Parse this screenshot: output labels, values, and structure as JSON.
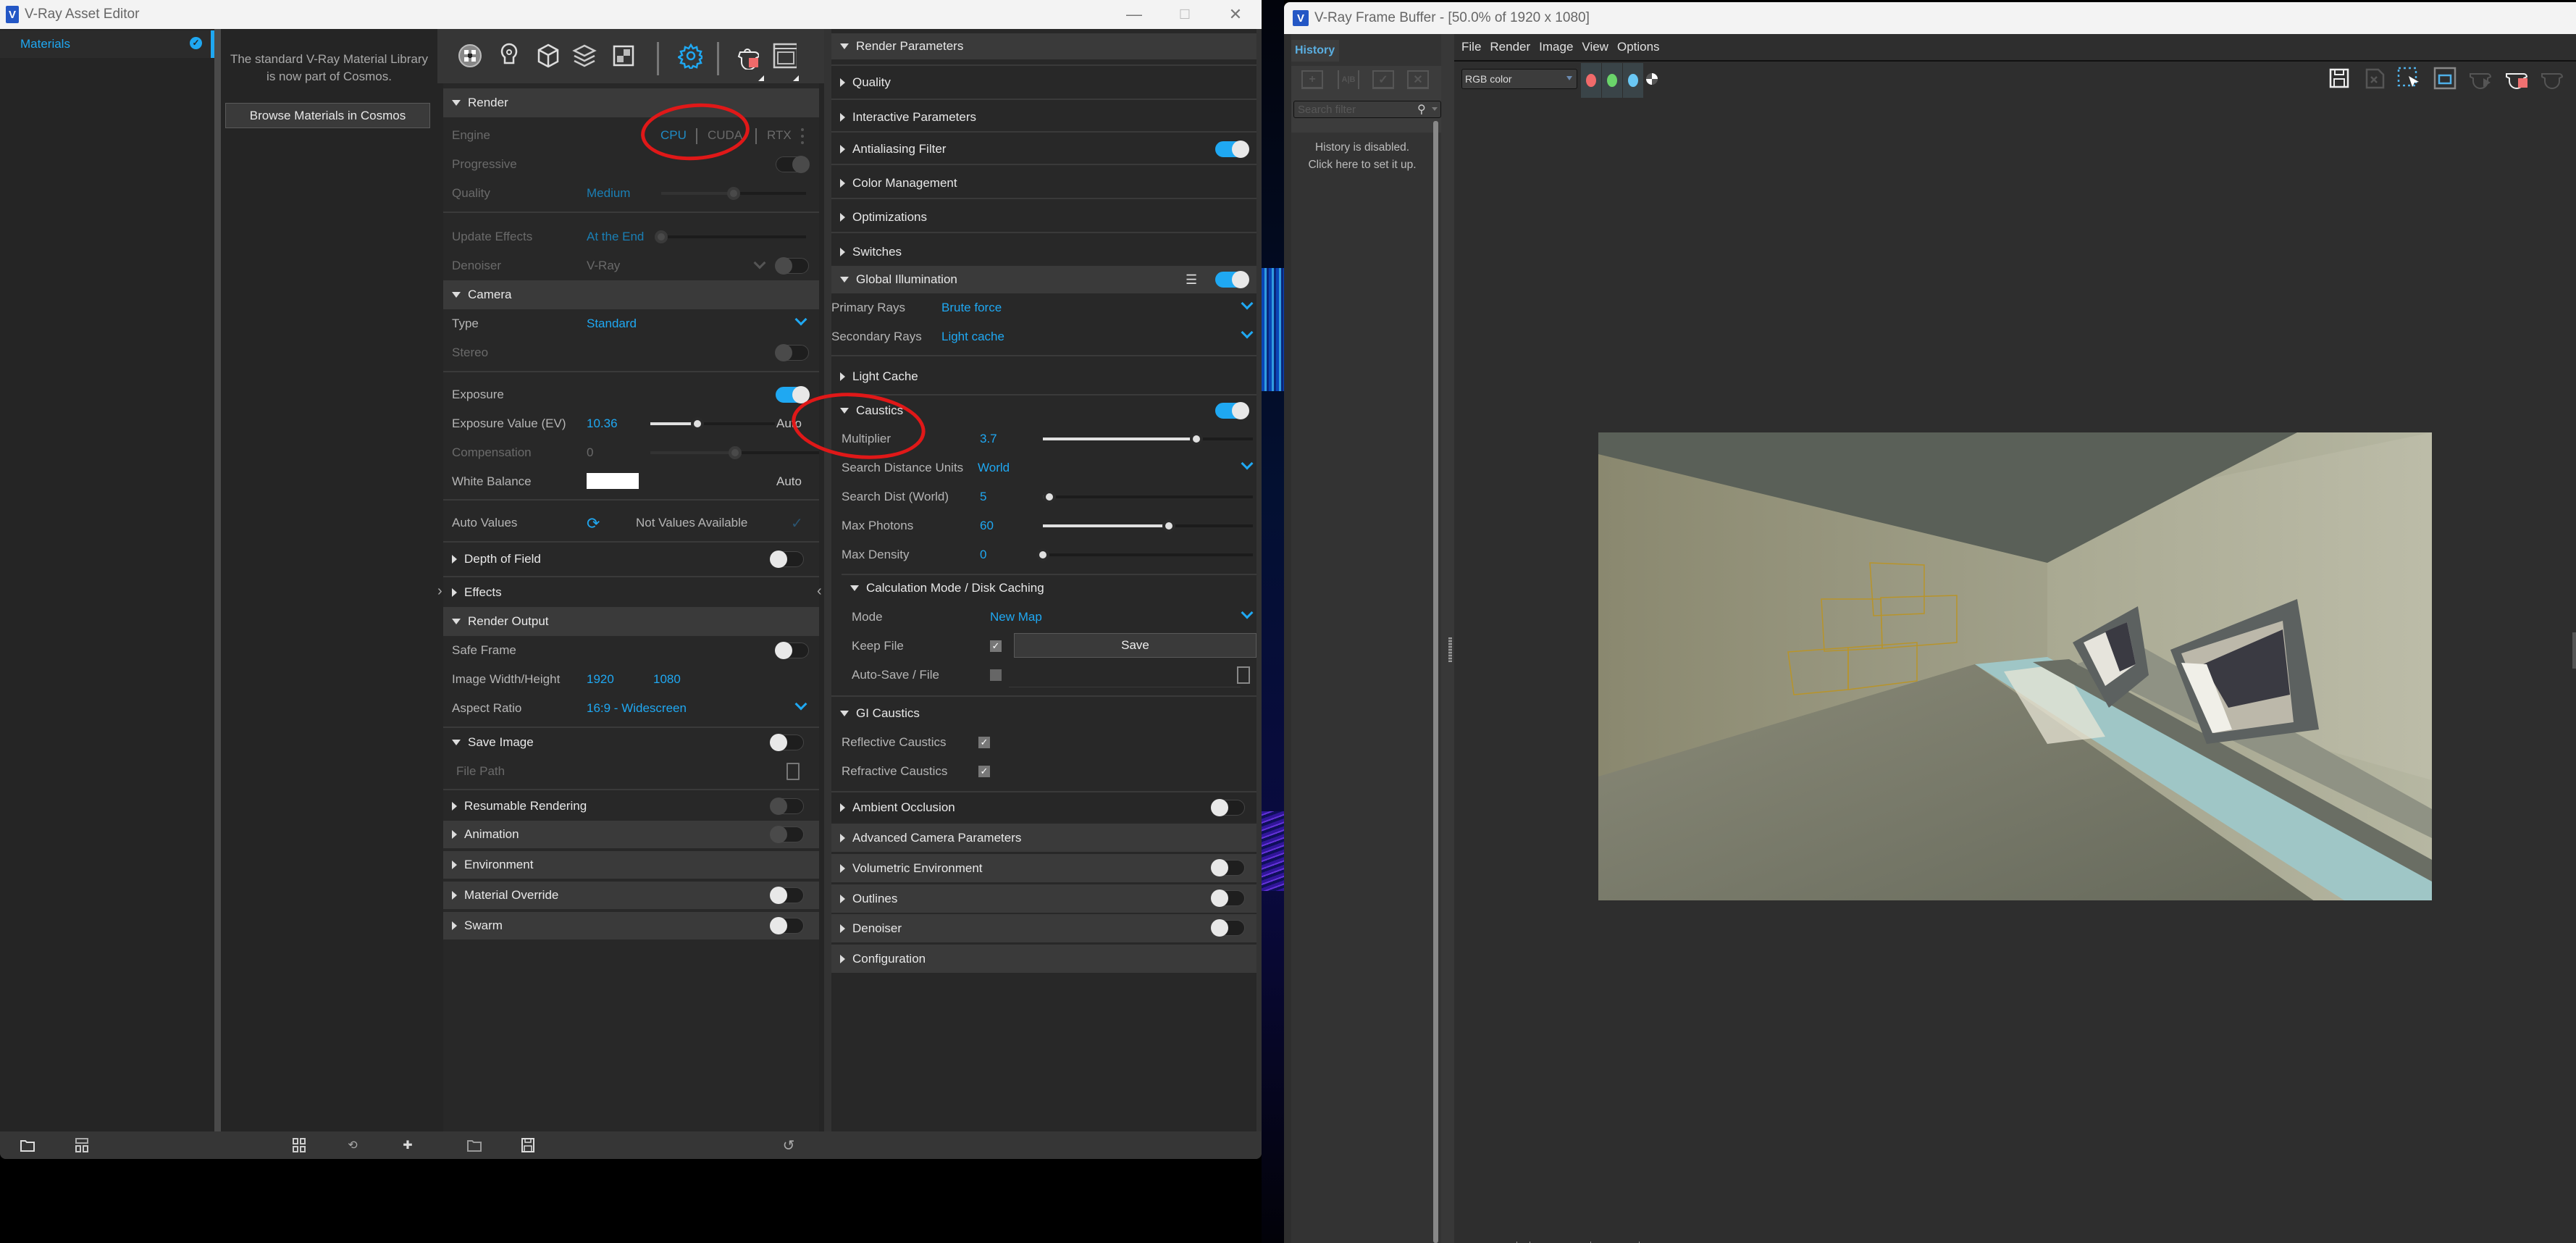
{
  "asset_editor": {
    "title": "V-Ray Asset Editor",
    "logo": "V",
    "window_controls": {
      "minimize": "—",
      "maximize": "☐",
      "close": "✕"
    },
    "sidebar": {
      "items": [
        {
          "label": "Materials",
          "icon": "vray-check-icon",
          "selected": true
        }
      ]
    },
    "cosmos": {
      "message": "The standard V-Ray Material Library is now part of Cosmos.",
      "button": "Browse Materials in Cosmos"
    },
    "toolbar_icons": [
      "materials-icon",
      "lights-icon",
      "geometry-icon",
      "layers-icon",
      "textures-icon",
      "settings-icon",
      "render-interactive-icon",
      "frame-buffer-icon"
    ],
    "active_toolbar_icon": "settings-icon",
    "bottom_toolbar_icons": [
      "open-file-icon",
      "view-layout-icon",
      "grid-view-icon",
      "search-scene-icon",
      "add-to-scene-icon",
      "open-settings-icon",
      "save-settings-icon",
      "revert-icon"
    ],
    "settings": {
      "render": {
        "title": "Render",
        "engine_label": "Engine",
        "engines": [
          "CPU",
          "CUDA",
          "RTX"
        ],
        "engine_selected": "CPU",
        "progressive_label": "Progressive",
        "progressive_on": true,
        "quality_label": "Quality",
        "quality_value": "Medium",
        "quality_fraction": 0.5,
        "update_effects_label": "Update Effects",
        "update_effects_value": "At the End",
        "update_effects_fraction": 0.0,
        "denoiser_label": "Denoiser",
        "denoiser_value": "V-Ray",
        "denoiser_on": false
      },
      "camera": {
        "title": "Camera",
        "type_label": "Type",
        "type_value": "Standard",
        "stereo_label": "Stereo",
        "stereo_on": false,
        "exposure_label": "Exposure",
        "exposure_on": true,
        "ev_label": "Exposure Value (EV)",
        "ev_value": "10.36",
        "ev_fraction": 0.38,
        "ev_auto": "Auto",
        "compensation_label": "Compensation",
        "compensation_value": "0",
        "compensation_fraction": 0.5,
        "white_balance_label": "White Balance",
        "white_balance_color": "#ffffff",
        "white_balance_auto": "Auto",
        "auto_values_label": "Auto Values",
        "auto_values_status": "Not Values Available"
      },
      "depth_of_field": {
        "title": "Depth of Field",
        "on": false
      },
      "effects": {
        "title": "Effects"
      },
      "render_output": {
        "title": "Render Output",
        "safe_frame_label": "Safe Frame",
        "safe_frame_on": false,
        "size_label": "Image Width/Height",
        "width": "1920",
        "height": "1080",
        "aspect_label": "Aspect Ratio",
        "aspect_value": "16:9 - Widescreen"
      },
      "save_image": {
        "title": "Save Image",
        "on": false,
        "file_path_placeholder": "File Path"
      },
      "resumable_rendering": {
        "title": "Resumable Rendering",
        "on": false
      },
      "animation": {
        "title": "Animation",
        "on": false
      },
      "environment": {
        "title": "Environment"
      },
      "material_override": {
        "title": "Material Override",
        "on": false
      },
      "swarm": {
        "title": "Swarm",
        "on": false
      }
    },
    "render_parameters": {
      "title": "Render Parameters",
      "quality": "Quality",
      "interactive_parameters": "Interactive Parameters",
      "antialiasing_filter": {
        "title": "Antialiasing Filter",
        "on": true
      },
      "color_management": "Color Management",
      "optimizations": "Optimizations",
      "switches": "Switches",
      "global_illumination": {
        "title": "Global Illumination",
        "on": true,
        "primary_rays_label": "Primary Rays",
        "primary_rays_value": "Brute force",
        "secondary_rays_label": "Secondary Rays",
        "secondary_rays_value": "Light cache"
      },
      "light_cache": "Light Cache",
      "caustics": {
        "title": "Caustics",
        "on": true,
        "multiplier_label": "Multiplier",
        "multiplier_value": "3.7",
        "multiplier_fraction": 0.73,
        "search_units_label": "Search Distance Units",
        "search_units_value": "World",
        "search_dist_label": "Search Dist (World)",
        "search_dist_value": "5",
        "search_dist_fraction": 0.03,
        "max_photons_label": "Max Photons",
        "max_photons_value": "60",
        "max_photons_fraction": 0.6,
        "max_density_label": "Max Density",
        "max_density_value": "0",
        "max_density_fraction": 0.0,
        "calc_mode": {
          "title": "Calculation Mode / Disk Caching",
          "mode_label": "Mode",
          "mode_value": "New Map",
          "keep_file_label": "Keep File",
          "keep_file_checked": true,
          "save_button": "Save",
          "autosave_label": "Auto-Save / File",
          "autosave_checked": false
        }
      },
      "gi_caustics": {
        "title": "GI Caustics",
        "reflective_label": "Reflective Caustics",
        "reflective_checked": true,
        "refractive_label": "Refractive Caustics",
        "refractive_checked": true
      },
      "ambient_occlusion": {
        "title": "Ambient Occlusion",
        "on": false
      },
      "advanced_camera": {
        "title": "Advanced Camera Parameters"
      },
      "volumetric_environment": {
        "title": "Volumetric Environment",
        "on": false
      },
      "outlines": {
        "title": "Outlines",
        "on": false
      },
      "denoiser": {
        "title": "Denoiser",
        "on": false
      },
      "configuration": {
        "title": "Configuration"
      }
    }
  },
  "frame_buffer": {
    "title": "V-Ray Frame Buffer - [50.0% of 1920 x 1080]",
    "logo": "V",
    "history": {
      "tab": "History",
      "search_placeholder": "Search filter",
      "message_line1": "History is disabled.",
      "message_line2": "Click here to set it up.",
      "tool_icons": [
        "save-to-history-icon",
        "ab-compare-icon",
        "load-history-icon",
        "remove-history-icon"
      ]
    },
    "menu": [
      "File",
      "Render",
      "Image",
      "View",
      "Options"
    ],
    "channel": "RGB color",
    "channel_buttons": [
      {
        "name": "red-channel",
        "color": "#f06a6a"
      },
      {
        "name": "green-channel",
        "color": "#6ad46a"
      },
      {
        "name": "blue-channel",
        "color": "#6ac8f5"
      }
    ],
    "toolbar_icons": [
      "save-image-icon",
      "clear-image-icon",
      "region-render-icon",
      "track-mouse-icon",
      "render-last-icon",
      "stop-render-icon",
      "interactive-render-icon"
    ]
  },
  "annotations": {
    "color": "#e01818",
    "circled": [
      "Engine CPU/CUDA",
      "Caustics Multiplier"
    ]
  },
  "colors": {
    "accent": "#1fa8f2",
    "panel": "#282828",
    "header": "#3a3a3a"
  }
}
